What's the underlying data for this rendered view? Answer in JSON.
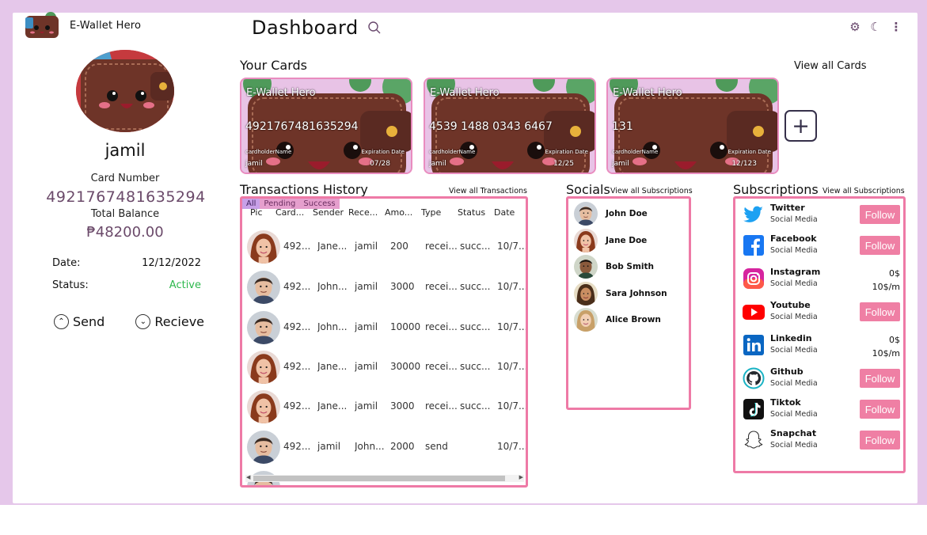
{
  "app": {
    "name": "E-Wallet Hero"
  },
  "header": {
    "title": "Dashboard"
  },
  "profile": {
    "username": "jamil",
    "card_number_label": "Card Number",
    "card_number": "4921767481635294",
    "total_balance_label": "Total Balance",
    "total_balance": "₱48200.00",
    "date_label": "Date:",
    "date_value": "12/12/2022",
    "status_label": "Status:",
    "status_value": "Active",
    "send_label": "Send",
    "receive_label": "Recieve"
  },
  "cards_section": {
    "title": "Your Cards",
    "view_all": "View all Cards",
    "cards": [
      {
        "brand": "E-Wallet Hero",
        "number": "4921767481635294",
        "holder_label": "cardholderName",
        "holder": "jamil",
        "exp_label": "Expiration Date",
        "exp": "07/28"
      },
      {
        "brand": "E-Wallet Hero",
        "number": "4539 1488 0343 6467",
        "holder_label": "cardholderName",
        "holder": "jamil",
        "exp_label": "Expiration Date",
        "exp": "12/25"
      },
      {
        "brand": "E-Wallet Hero",
        "number": "131",
        "holder_label": "cardholderName",
        "holder": "jamil",
        "exp_label": "Expiration Date",
        "exp": "12/123"
      }
    ]
  },
  "transactions": {
    "title": "Transactions History",
    "view_all": "View all Transactions",
    "filters": [
      "All",
      "Pending",
      "Success"
    ],
    "columns": [
      "Pic",
      "Card...",
      "Sender",
      "Rece...",
      "Amo...",
      "Type",
      "Status",
      "Date"
    ],
    "rows": [
      {
        "card": "492...",
        "sender": "Jane...",
        "receiver": "jamil",
        "amount": "200",
        "type": "recei...",
        "status": "succ...",
        "date": "10/7..."
      },
      {
        "card": "492...",
        "sender": "John...",
        "receiver": "jamil",
        "amount": "3000",
        "type": "recei...",
        "status": "succ...",
        "date": "10/7..."
      },
      {
        "card": "492...",
        "sender": "John...",
        "receiver": "jamil",
        "amount": "10000",
        "type": "recei...",
        "status": "succ...",
        "date": "10/7..."
      },
      {
        "card": "492...",
        "sender": "Jane...",
        "receiver": "jamil",
        "amount": "30000",
        "type": "recei...",
        "status": "succ...",
        "date": "10/7..."
      },
      {
        "card": "492...",
        "sender": "Jane...",
        "receiver": "jamil",
        "amount": "3000",
        "type": "recei...",
        "status": "succ...",
        "date": "10/7..."
      },
      {
        "card": "492...",
        "sender": "jamil",
        "receiver": "John...",
        "amount": "2000",
        "type": "send",
        "status": "",
        "date": "10/7..."
      }
    ]
  },
  "socials": {
    "title": "Socials",
    "view_all": "View all Subscriptions",
    "people": [
      "John Doe",
      "Jane Doe",
      "Bob Smith",
      "Sara Johnson",
      "Alice Brown"
    ]
  },
  "subscriptions": {
    "title": "Subscriptions",
    "view_all": "View all Subscriptions",
    "category": "Social Media",
    "items": [
      {
        "name": "Twitter",
        "action": "Follow"
      },
      {
        "name": "Facebook",
        "action": "Follow"
      },
      {
        "name": "Instagram",
        "price": "0$",
        "rate": "10$/m"
      },
      {
        "name": "Youtube",
        "action": "Follow"
      },
      {
        "name": "Linkedin",
        "price": "0$",
        "rate": "10$/m"
      },
      {
        "name": "Github",
        "action": "Follow"
      },
      {
        "name": "Tiktok",
        "action": "Follow"
      },
      {
        "name": "Snapchat",
        "action": "Follow"
      }
    ]
  },
  "colors": {
    "accent_pink": "#ee7aa6",
    "frame_lavender": "#e5c7ea",
    "status_green": "#2db84d",
    "balance_purple": "#6b4a6a"
  }
}
